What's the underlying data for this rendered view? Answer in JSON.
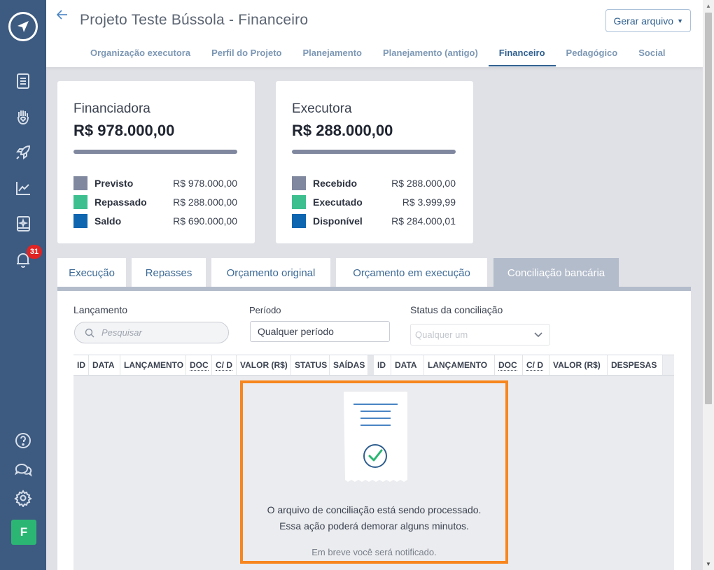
{
  "header": {
    "title": "Projeto Teste Bússola - Financeiro",
    "generate_button": "Gerar arquivo",
    "tabs": [
      {
        "label": "Organização executora"
      },
      {
        "label": "Perfil do Projeto"
      },
      {
        "label": "Planejamento"
      },
      {
        "label": "Planejamento (antigo)"
      },
      {
        "label": "Financeiro",
        "active": true
      },
      {
        "label": "Pedagógico"
      },
      {
        "label": "Social"
      }
    ]
  },
  "sidebar": {
    "items": [
      "documents-icon",
      "hand-heart-icon",
      "rocket-icon",
      "chart-line-icon",
      "book-icon",
      "bell-icon",
      "help-icon",
      "chat-icon",
      "gear-icon"
    ],
    "notification_count": "31",
    "avatar_letter": "F"
  },
  "financiadora": {
    "label": "Financiadora",
    "total": "R$ 978.000,00",
    "rows": [
      {
        "label": "Previsto",
        "value": "R$ 978.000,00",
        "color": "#7f889e"
      },
      {
        "label": "Repassado",
        "value": "R$ 288.000,00",
        "color": "#3dbf8f"
      },
      {
        "label": "Saldo",
        "value": "R$ 690.000,00",
        "color": "#0f66b0"
      }
    ]
  },
  "executora": {
    "label": "Executora",
    "total": "R$ 288.000,00",
    "rows": [
      {
        "label": "Recebido",
        "value": "R$ 288.000,00",
        "color": "#7f889e"
      },
      {
        "label": "Executado",
        "value": "R$ 3.999,99",
        "color": "#3dbf8f"
      },
      {
        "label": "Disponível",
        "value": "R$ 284.000,01",
        "color": "#0f66b0"
      }
    ]
  },
  "content_tabs": [
    {
      "label": "Execução"
    },
    {
      "label": "Repasses"
    },
    {
      "label": "Orçamento original"
    },
    {
      "label": "Orçamento em execução"
    },
    {
      "label": "Conciliação bancária",
      "active": true
    }
  ],
  "filters": {
    "lancamento_label": "Lançamento",
    "search_placeholder": "Pesquisar",
    "periodo_label": "Período",
    "periodo_value": "Qualquer período",
    "status_label": "Status da conciliação",
    "status_placeholder": "Qualquer um"
  },
  "table": {
    "left_headers": [
      "ID",
      "DATA",
      "LANÇAMENTO",
      "DOC",
      "C/ D",
      "VALOR (R$)",
      "STATUS",
      "SAÍDAS"
    ],
    "right_headers": [
      "ID",
      "DATA",
      "LANÇAMENTO",
      "DOC",
      "C/ D",
      "VALOR (R$)",
      "DESPESAS"
    ]
  },
  "notice": {
    "line1": "O arquivo de conciliação está sendo processado.",
    "line2": "Essa ação poderá demorar alguns minutos.",
    "line3": "Em breve você será notificado."
  }
}
